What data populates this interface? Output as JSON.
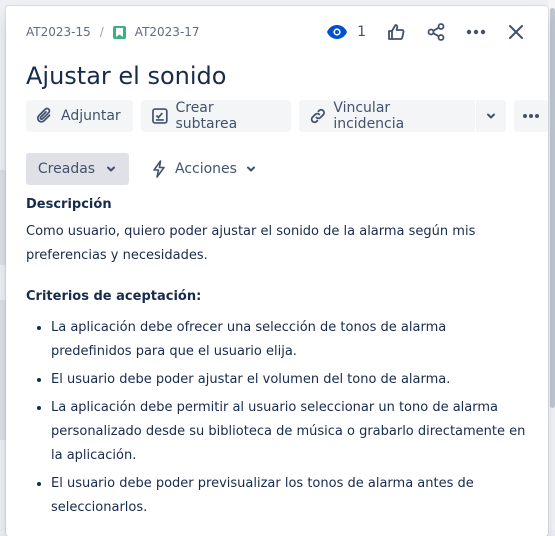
{
  "breadcrumb": {
    "parent": "AT2023-15",
    "separator": "/",
    "current": "AT2023-17"
  },
  "header": {
    "watch_count": "1"
  },
  "issue": {
    "title": "Ajustar el sonido"
  },
  "toolbar": {
    "attach_label": "Adjuntar",
    "subtask_label": "Crear subtarea",
    "link_label": "Vincular incidencia"
  },
  "status": {
    "label": "Creadas"
  },
  "actions": {
    "label": "Acciones"
  },
  "description": {
    "heading": "Descripción",
    "text": "Como usuario, quiero poder ajustar el sonido de la alarma según mis preferencias y necesidades.",
    "criteria_heading": "Criterios de aceptación:",
    "criteria": [
      "La aplicación debe ofrecer una selección de tonos de alarma predefinidos para que el usuario elija.",
      "El usuario debe poder ajustar el volumen del tono de alarma.",
      "La aplicación debe permitir al usuario seleccionar un tono de alarma personalizado desde su biblioteca de música o grabarlo directamente en la aplicación.",
      "El usuario debe poder previsualizar los tonos de alarma antes de seleccionarlos."
    ]
  },
  "colors": {
    "brand": "#0052cc",
    "story": "#36b37e",
    "text": "#172b4d",
    "subtle": "#42526e"
  }
}
